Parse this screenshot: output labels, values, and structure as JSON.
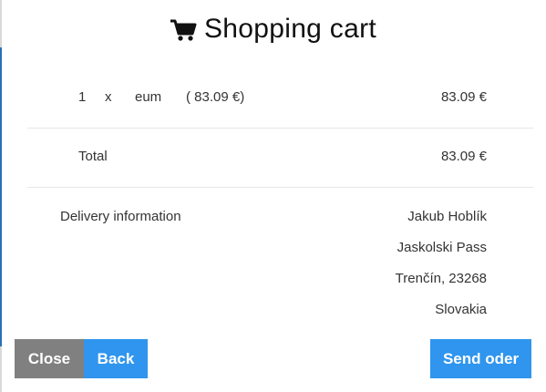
{
  "header": {
    "title": "Shopping cart",
    "icon": "shopping-cart-icon"
  },
  "items": [
    {
      "qty": "1",
      "times": "x",
      "name": "eum",
      "unit_price": "( 83.09 €)",
      "amount": "83.09 €"
    }
  ],
  "total": {
    "label": "Total",
    "amount": "83.09 €"
  },
  "delivery": {
    "label": "Delivery information",
    "name": "Jakub Hoblík",
    "street": "Jaskolski Pass",
    "city": "Trenčín, 23268",
    "country": "Slovakia"
  },
  "buttons": {
    "close": "Close",
    "back": "Back",
    "send": "Send oder"
  },
  "colors": {
    "primary": "#2f95ee",
    "secondary": "#808080",
    "text": "#333333"
  }
}
